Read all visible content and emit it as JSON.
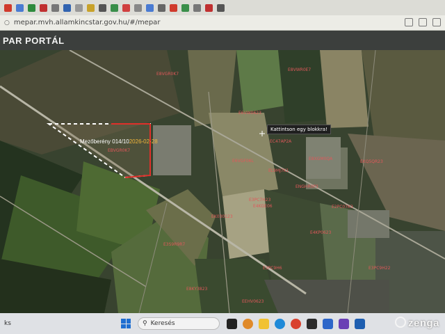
{
  "browser": {
    "url": "mepar.mvh.allamkincstar.gov.hu/#/mepar"
  },
  "portal": {
    "title": "PAR PORTÁL"
  },
  "map": {
    "tooltip": "Kattintson egy blokkra!",
    "selected_block_label": "Mezőberény 014/10",
    "selected_block_date": "2026-02-28",
    "parcel_labels": [
      "EBVGR0K7",
      "E8VGR0K7",
      "E6VW0623",
      "E6VGF06L",
      "E8VWR0E7",
      "EC47AP2A",
      "EL9MJ7K1",
      "E8XGM0QA",
      "ENGHR0P3",
      "EKQ5QR23",
      "E3PC7H23",
      "E4KGE06",
      "EK030123",
      "E2PC07K3",
      "E4KP0623",
      "E3S9R9R7",
      "E8KY3823",
      "E3PC9H6",
      "E3PC9H22",
      "EEHV0623"
    ]
  },
  "taskbar": {
    "edge_text": "ks",
    "search_placeholder": "Keresés",
    "watermark": "zenga"
  }
}
